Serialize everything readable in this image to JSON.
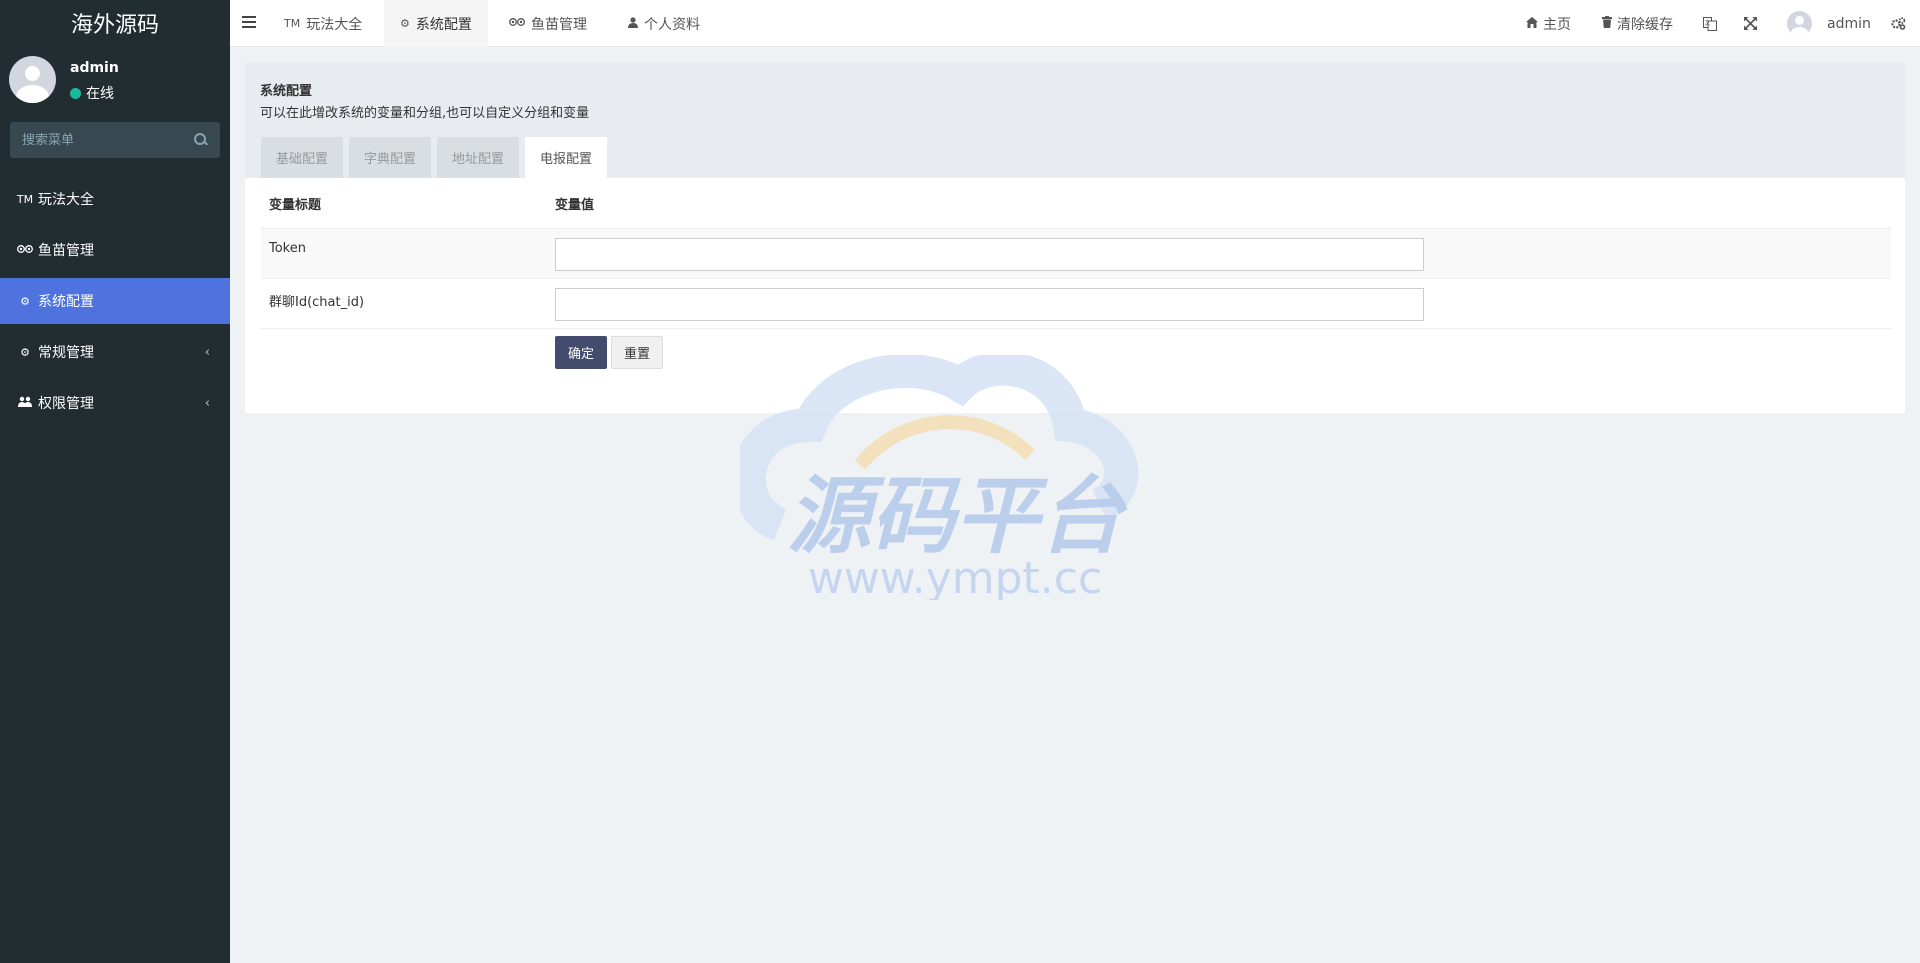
{
  "brand": "海外源码",
  "user": {
    "name": "admin",
    "status": "在线"
  },
  "search": {
    "placeholder": "搜索菜单"
  },
  "sidebar": {
    "items": [
      {
        "icon": "tm-icon",
        "label": "玩法大全",
        "active": false
      },
      {
        "icon": "tripadvisor-icon",
        "label": "鱼苗管理",
        "active": false
      },
      {
        "icon": "gear-icon",
        "label": "系统配置",
        "active": true
      },
      {
        "icon": "gears-icon",
        "label": "常规管理",
        "active": false,
        "expandable": true
      },
      {
        "icon": "users-icon",
        "label": "权限管理",
        "active": false,
        "expandable": true
      }
    ]
  },
  "topbar": {
    "tabs": [
      {
        "icon": "tm-icon",
        "label": "玩法大全"
      },
      {
        "icon": "gear-icon",
        "label": "系统配置",
        "active": true
      },
      {
        "icon": "tripadvisor-icon",
        "label": "鱼苗管理"
      },
      {
        "icon": "user-icon",
        "label": "个人资料"
      }
    ],
    "home_label": "主页",
    "clear_cache_label": "清除缓存",
    "username": "admin"
  },
  "panel": {
    "title": "系统配置",
    "description": "可以在此增改系统的变量和分组,也可以自定义分组和变量",
    "tabs": [
      "基础配置",
      "字典配置",
      "地址配置",
      "电报配置"
    ],
    "active_tab": "电报配置"
  },
  "table": {
    "col_title": "变量标题",
    "col_value": "变量值",
    "fields": [
      {
        "label": "Token",
        "value": ""
      },
      {
        "label": "群聊Id(chat_id)",
        "value": ""
      }
    ],
    "submit_label": "确定",
    "reset_label": "重置"
  },
  "watermark": {
    "text": "源码平台",
    "url": "www.ympt.cc"
  },
  "colors": {
    "sidebar_bg": "#222d32",
    "active_menu": "#4e73df",
    "primary_button": "#444c6e",
    "status_online": "#18bc9c"
  }
}
